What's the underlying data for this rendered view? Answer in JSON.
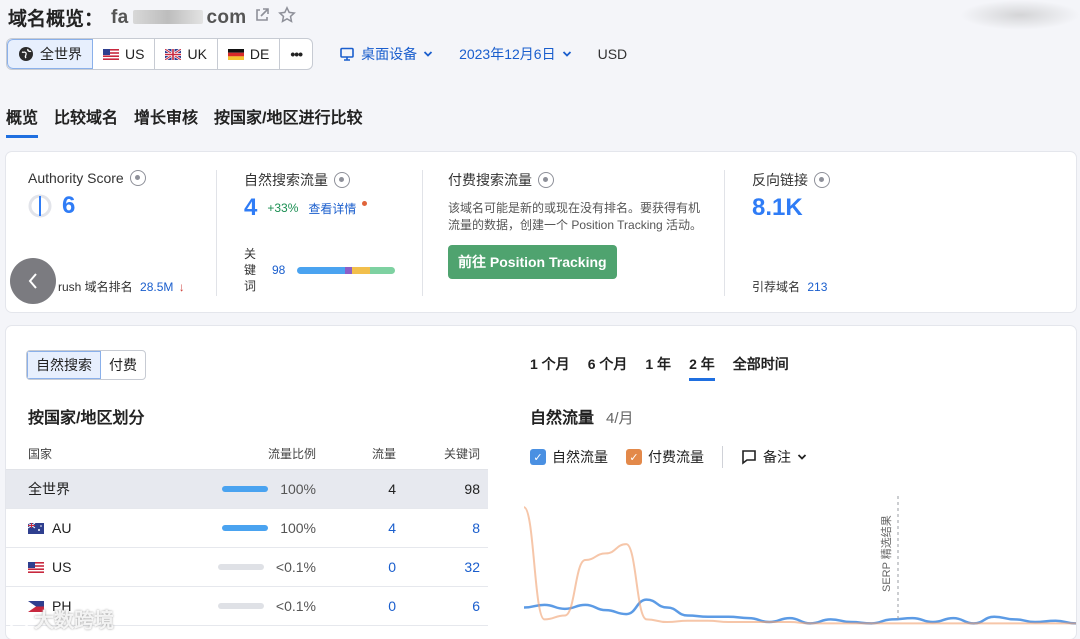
{
  "header": {
    "title": "域名概览：",
    "domain_prefix": "fa",
    "domain_suffix": "com",
    "scope": {
      "items": [
        {
          "label": "全世界",
          "icon": "globe-icon"
        },
        {
          "label": "US",
          "icon": "us-flag-icon"
        },
        {
          "label": "UK",
          "icon": "uk-flag-icon"
        },
        {
          "label": "DE",
          "icon": "de-flag-icon"
        },
        {
          "label": "•••",
          "icon": "more-icon"
        }
      ]
    },
    "device": "桌面设备",
    "date": "2023年12月6日",
    "currency": "USD"
  },
  "tabs": [
    "概览",
    "比较域名",
    "增长审核",
    "按国家/地区进行比较"
  ],
  "metrics": {
    "authority": {
      "label": "Authority Score",
      "value": "6",
      "rank_label": "rush 域名排名",
      "rank_value": "28.5M"
    },
    "organic": {
      "label": "自然搜索流量",
      "value": "4",
      "change": "+33%",
      "details_link": "查看详情",
      "keywords_label": "关键词",
      "keywords_value": "98"
    },
    "paid": {
      "label": "付费搜索流量",
      "description": "该域名可能是新的或现在没有排名。要获得有机流量的数据，创建一个 Position Tracking 活动。",
      "button": "前往 Position Tracking"
    },
    "backlinks": {
      "label": "反向链接",
      "value": "8.1K",
      "ref_label": "引荐域名",
      "ref_value": "213"
    }
  },
  "bottom": {
    "toggle": [
      "自然搜索",
      "付费"
    ],
    "country_title": "按国家/地区划分",
    "table": {
      "headers": [
        "国家",
        "流量比例",
        "流量",
        "关键词"
      ],
      "rows": [
        {
          "country": "全世界",
          "share": "100%",
          "traffic": "4",
          "keywords": "98"
        },
        {
          "country": "AU",
          "share": "100%",
          "traffic": "4",
          "keywords": "8"
        },
        {
          "country": "US",
          "share": "<0.1%",
          "traffic": "0",
          "keywords": "32"
        },
        {
          "country": "PH",
          "share": "<0.1%",
          "traffic": "0",
          "keywords": "6"
        }
      ]
    },
    "periods": [
      "1 个月",
      "6 个月",
      "1 年",
      "2 年",
      "全部时间"
    ],
    "chart_title": "自然流量",
    "chart_subtitle": "4/月",
    "legend": {
      "organic": "自然流量",
      "paid": "付费流量",
      "notes": "备注"
    },
    "serp_label": "SERP 精选结果"
  },
  "watermark": "大数跨境",
  "chart_data": {
    "type": "line",
    "series": [
      {
        "name": "自然流量",
        "color": "#4a90e2",
        "values": [
          0.14,
          0.16,
          0.13,
          0.16,
          0.12,
          0.09,
          0.2,
          0.14,
          0.08,
          0.07,
          0.07,
          0.06,
          0.03,
          0.06,
          0.02,
          0.05,
          0.03,
          0.02,
          0.05,
          0.06,
          0.03,
          0.06,
          0.02,
          0.07,
          0.05,
          0.03,
          0.04,
          0.02
        ]
      },
      {
        "name": "付费流量",
        "color": "#f0a070",
        "values": [
          0.9,
          0.05,
          0.08,
          0.5,
          0.55,
          0.62,
          0.05,
          0.03,
          0.04,
          0.04,
          0.03,
          0.03,
          0.03,
          0.03,
          0.02,
          0.02,
          0.02,
          0.02,
          0.02,
          0.02,
          0.02,
          0.02,
          0.02,
          0.02,
          0.02,
          0.02,
          0.02,
          0.02
        ]
      }
    ]
  }
}
